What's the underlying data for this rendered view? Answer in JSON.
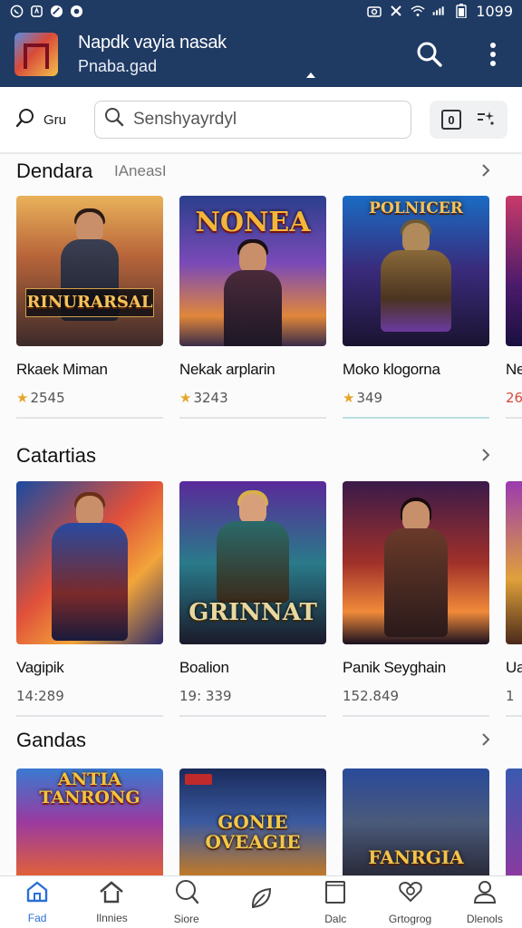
{
  "status_bar": {
    "left_icons": [
      "whatsapp-icon",
      "sync-icon",
      "no-entry-icon",
      "circle-icon"
    ],
    "right_icons": [
      "camera-icon",
      "mute-icon",
      "wifi-icon",
      "signal-icon",
      "battery-icon"
    ],
    "time": "1099"
  },
  "app_bar": {
    "title": "Napdk vayia nasak",
    "subtitle": "Pnaba.gad",
    "actions": [
      "search-icon",
      "more-vert-icon"
    ],
    "color": "#1f3a63"
  },
  "search": {
    "scope_label": "Gru",
    "placeholder": "Senshyayrdyl",
    "filter_badge": "0"
  },
  "sections": [
    {
      "title": "Dendara",
      "subtitle": "IAneasI",
      "cards": [
        {
          "name": "Rkaek Miman",
          "meta": "2545",
          "rated": true,
          "art_text": "RINURARSAL"
        },
        {
          "name": "Nekak arplarin",
          "meta": "3243",
          "rated": true,
          "art_text": "NONEA"
        },
        {
          "name": "Moko klogorna",
          "meta": "349",
          "rated": true,
          "art_text": "POLNICER"
        },
        {
          "name": "Ne",
          "meta": "26",
          "rated": false,
          "art_text": ""
        }
      ]
    },
    {
      "title": "Catartias",
      "subtitle": "",
      "cards": [
        {
          "name": "Vagipik",
          "meta": "14:289",
          "rated": false,
          "art_text": ""
        },
        {
          "name": "Boalion",
          "meta": "19: 339",
          "rated": false,
          "art_text": "GRINNAT"
        },
        {
          "name": "Panik Seyghain",
          "meta": "152.849",
          "rated": false,
          "art_text": ""
        },
        {
          "name": "Ua",
          "meta": "1",
          "rated": false,
          "art_text": ""
        }
      ]
    },
    {
      "title": "Gandas",
      "subtitle": "",
      "cards": [
        {
          "name": "",
          "meta": "",
          "rated": false,
          "art_text": "ANTIA TANRONG"
        },
        {
          "name": "",
          "meta": "",
          "rated": false,
          "art_text": "GONIE OVEAGIE"
        },
        {
          "name": "",
          "meta": "",
          "rated": false,
          "art_text": "FANRGIA"
        },
        {
          "name": "",
          "meta": "",
          "rated": false,
          "art_text": ""
        }
      ]
    }
  ],
  "bottom_nav": [
    {
      "label": "Fad",
      "icon": "home-icon",
      "active": true
    },
    {
      "label": "Ilnnies",
      "icon": "library-icon",
      "active": false
    },
    {
      "label": "Siore",
      "icon": "search-icon",
      "active": false
    },
    {
      "label": "",
      "icon": "leaf-icon",
      "active": false
    },
    {
      "label": "Dalc",
      "icon": "book-icon",
      "active": false
    },
    {
      "label": "Grtogrog",
      "icon": "heart-search-icon",
      "active": false
    },
    {
      "label": "Dlenols",
      "icon": "profile-icon",
      "active": false
    }
  ],
  "colors": {
    "brand": "#1f3a63",
    "accent": "#2a6fd6",
    "star": "#e7a52a"
  }
}
